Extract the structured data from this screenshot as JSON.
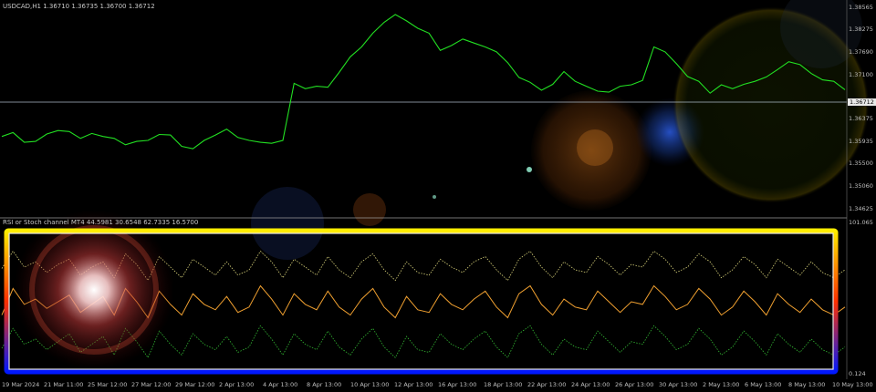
{
  "chart_data": [
    {
      "type": "line",
      "series": [
        {
          "values": [
            1.36,
            1.3608,
            1.3588,
            1.359,
            1.3605,
            1.3612,
            1.361,
            1.3596,
            1.3606,
            1.36,
            1.3596,
            1.3583,
            1.359,
            1.3592,
            1.3604,
            1.3603,
            1.358,
            1.3575,
            1.3592,
            1.3603,
            1.3615,
            1.3598,
            1.3592,
            1.3588,
            1.3586,
            1.3592,
            1.3708,
            1.3697,
            1.3702,
            1.37,
            1.373,
            1.3762,
            1.3782,
            1.381,
            1.3832,
            1.3848,
            1.3835,
            1.382,
            1.381,
            1.3775,
            1.3785,
            1.3798,
            1.379,
            1.3782,
            1.3772,
            1.375,
            1.372,
            1.371,
            1.3694,
            1.3706,
            1.3732,
            1.3712,
            1.3702,
            1.3692,
            1.369,
            1.3702,
            1.3705,
            1.3714,
            1.3782,
            1.3772,
            1.3748,
            1.3722,
            1.3712,
            1.3688,
            1.3705,
            1.3697,
            1.3706,
            1.3712,
            1.3721,
            1.3736,
            1.3752,
            1.3746,
            1.3728,
            1.3715,
            1.3712,
            1.3695
          ]
        }
      ],
      "y_ticks": [
        "1.38565",
        "1.38275",
        "1.37690",
        "1.37100",
        "1.36375",
        "1.35935",
        "1.35500",
        "1.35060",
        "1.34625"
      ],
      "current_price": "1.36712"
    },
    {
      "type": "line",
      "series": [
        {
          "values": [
            40,
            60,
            48,
            52,
            45,
            50,
            55,
            42,
            48,
            54,
            40,
            60,
            50,
            38,
            58,
            48,
            40,
            56,
            48,
            44,
            54,
            42,
            46,
            62,
            52,
            40,
            56,
            48,
            44,
            58,
            46,
            40,
            52,
            60,
            46,
            38,
            54,
            44,
            42,
            56,
            48,
            44,
            52,
            58,
            46,
            38,
            56,
            62,
            48,
            40,
            52,
            46,
            44,
            58,
            50,
            42,
            50,
            48,
            62,
            54,
            44,
            48,
            60,
            52,
            40,
            46,
            58,
            50,
            40,
            56,
            48,
            42,
            52,
            44,
            40,
            46
          ]
        },
        {
          "values": [
            75,
            88,
            76,
            80,
            72,
            78,
            82,
            70,
            76,
            80,
            68,
            86,
            78,
            66,
            84,
            76,
            68,
            82,
            76,
            70,
            80,
            70,
            74,
            88,
            80,
            68,
            82,
            76,
            70,
            84,
            74,
            68,
            80,
            86,
            74,
            66,
            80,
            72,
            70,
            82,
            76,
            72,
            80,
            84,
            74,
            66,
            82,
            88,
            76,
            68,
            80,
            74,
            72,
            84,
            78,
            70,
            78,
            76,
            88,
            82,
            72,
            76,
            86,
            80,
            68,
            74,
            84,
            78,
            68,
            82,
            76,
            70,
            80,
            72,
            68,
            74
          ]
        },
        {
          "values": [
            15,
            30,
            18,
            22,
            14,
            20,
            26,
            12,
            18,
            24,
            10,
            30,
            20,
            8,
            28,
            18,
            10,
            26,
            18,
            14,
            24,
            12,
            16,
            32,
            22,
            10,
            26,
            18,
            14,
            28,
            16,
            10,
            22,
            30,
            16,
            8,
            24,
            14,
            12,
            26,
            18,
            14,
            22,
            28,
            16,
            8,
            26,
            32,
            18,
            10,
            22,
            16,
            14,
            28,
            20,
            12,
            20,
            18,
            32,
            24,
            14,
            18,
            30,
            22,
            10,
            16,
            28,
            20,
            10,
            26,
            18,
            12,
            22,
            14,
            10,
            16
          ]
        }
      ],
      "y_ticks": [
        "101.065",
        "0.124"
      ]
    }
  ],
  "header": {
    "symbol_info": "USDCAD,H1  1.36710 1.36735 1.36700 1.36712",
    "indicator_info": "RSI or Stoch channel MT4 44.5981 30.6548 62.7335 16.5700"
  },
  "x_ticks": [
    "19 Mar 2024",
    "21 Mar 11:00",
    "25 Mar 12:00",
    "27 Mar 12:00",
    "29 Mar 12:00",
    "2 Apr 13:00",
    "4 Apr 13:00",
    "8 Apr 13:00",
    "10 Apr 13:00",
    "12 Apr 13:00",
    "16 Apr 13:00",
    "18 Apr 13:00",
    "22 Apr 13:00",
    "24 Apr 13:00",
    "26 Apr 13:00",
    "30 Apr 13:00",
    "2 May 13:00",
    "6 May 13:00",
    "8 May 13:00",
    "10 May 13:00"
  ],
  "colors": {
    "price_line": "#22e022",
    "indicator_line": "#f0a030",
    "upper_channel": "#d8d27a",
    "lower_channel": "#33b833",
    "current_price_line": "#aab8c8",
    "frame_gradient": [
      "#ffe600",
      "#ff2a00",
      "#0010ff"
    ]
  }
}
